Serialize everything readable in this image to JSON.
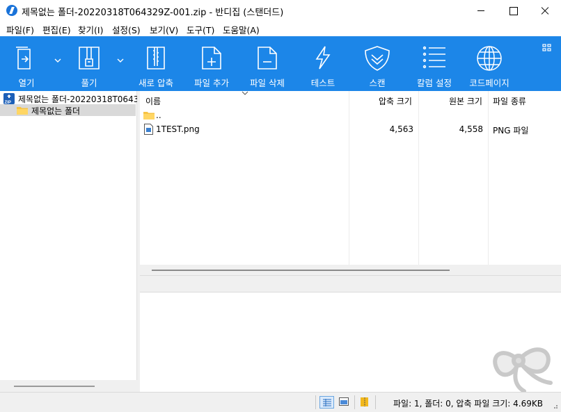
{
  "window": {
    "title": "제목없는 폴더-20220318T064329Z-001.zip - 반디집 (스탠더드)"
  },
  "menu": [
    {
      "label": "파일(F)"
    },
    {
      "label": "편집(E)"
    },
    {
      "label": "찾기(I)"
    },
    {
      "label": "설정(S)"
    },
    {
      "label": "보기(V)"
    },
    {
      "label": "도구(T)"
    },
    {
      "label": "도움말(A)"
    }
  ],
  "toolbar": {
    "accent": "#1c86e8",
    "buttons": [
      {
        "label": "열기",
        "icon": "open-archive-icon"
      },
      {
        "label": "풀기",
        "icon": "extract-zipper-icon"
      },
      {
        "label": "새로 압축",
        "icon": "new-archive-icon"
      },
      {
        "label": "파일 추가",
        "icon": "add-file-icon"
      },
      {
        "label": "파일 삭제",
        "icon": "delete-file-icon"
      },
      {
        "label": "테스트",
        "icon": "lightning-icon"
      },
      {
        "label": "스캔",
        "icon": "shield-scan-icon"
      },
      {
        "label": "칼럼 설정",
        "icon": "column-list-icon"
      },
      {
        "label": "코드페이지",
        "icon": "globe-icon"
      }
    ]
  },
  "tree": {
    "root": "제목없는 폴더-20220318T0643",
    "child": "제목없는 폴더"
  },
  "list": {
    "columns": [
      "이름",
      "압축 크기",
      "원본 크기",
      "파일 종류"
    ],
    "rows": [
      {
        "name": "..",
        "icon": "folder-up-icon",
        "packed": "",
        "size": "",
        "type": ""
      },
      {
        "name": "1TEST.png",
        "icon": "image-file-icon",
        "packed": "4,563",
        "size": "4,558",
        "type": "PNG 파일"
      }
    ]
  },
  "status": {
    "text": "파일: 1, 폴더: 0, 압축 파일 크기: 4.69KB"
  }
}
